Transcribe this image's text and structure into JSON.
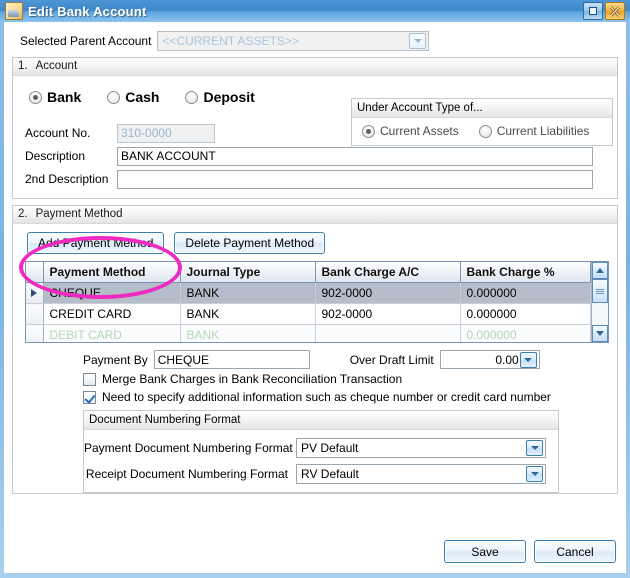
{
  "window": {
    "title": "Edit Bank Account",
    "icon": "document-window-icon",
    "buttons": {
      "maximize": "maximize-restore",
      "close": "close"
    },
    "accent_blue": "#3d88cb",
    "annotation_color": "#ef2ac0"
  },
  "parent_account": {
    "label": "Selected Parent Account",
    "value": "<<CURRENT ASSETS>>"
  },
  "section_account": {
    "number": "1.",
    "title": "Account",
    "types": [
      {
        "label": "Bank",
        "checked": true
      },
      {
        "label": "Cash",
        "checked": false
      },
      {
        "label": "Deposit",
        "checked": false
      }
    ],
    "under_account_type": {
      "title": "Under Account Type of...",
      "options": [
        {
          "label": "Current Assets",
          "checked": true
        },
        {
          "label": "Current Liabilities",
          "checked": false
        }
      ]
    },
    "fields": [
      {
        "label": "Account No.",
        "value": "310-0000",
        "placeholder": "",
        "readonly": true
      },
      {
        "label": "Description",
        "value": "BANK ACCOUNT",
        "placeholder": "",
        "readonly": false
      },
      {
        "label": "2nd Description",
        "value": "",
        "placeholder": "",
        "readonly": false
      }
    ]
  },
  "section_payment": {
    "number": "2.",
    "title": "Payment Method",
    "add_button": "Add Payment Method",
    "delete_button": "Delete Payment Method",
    "grid": {
      "columns": [
        "Payment Method",
        "Journal Type",
        "Bank Charge A/C",
        "Bank Charge %"
      ],
      "rows": [
        {
          "marker": true,
          "selected": true,
          "new": false,
          "cells": [
            "CHEQUE",
            "BANK",
            "902-0000",
            "0.000000"
          ]
        },
        {
          "marker": false,
          "selected": false,
          "new": false,
          "cells": [
            "CREDIT CARD",
            "BANK",
            "902-0000",
            "0.000000"
          ]
        },
        {
          "marker": false,
          "selected": false,
          "new": true,
          "cells": [
            "DEBIT CARD",
            "BANK",
            "",
            "0.000000"
          ]
        }
      ]
    },
    "payment_by": {
      "label": "Payment By",
      "value": "CHEQUE"
    },
    "over_draft_limit": {
      "label": "Over Draft Limit",
      "value": "0.00"
    },
    "checkboxes": [
      {
        "label": "Merge Bank Charges in Bank Reconciliation Transaction",
        "checked": false
      },
      {
        "label": "Need to specify additional information such as cheque number or credit card number",
        "checked": true
      }
    ],
    "document_numbering": {
      "title": "Document Numbering Format",
      "rows": [
        {
          "label": "Payment Document Numbering Format",
          "value": "PV Default"
        },
        {
          "label": "Receipt Document Numbering Format",
          "value": "RV Default"
        }
      ]
    }
  },
  "footer": {
    "save": "Save",
    "cancel": "Cancel"
  }
}
